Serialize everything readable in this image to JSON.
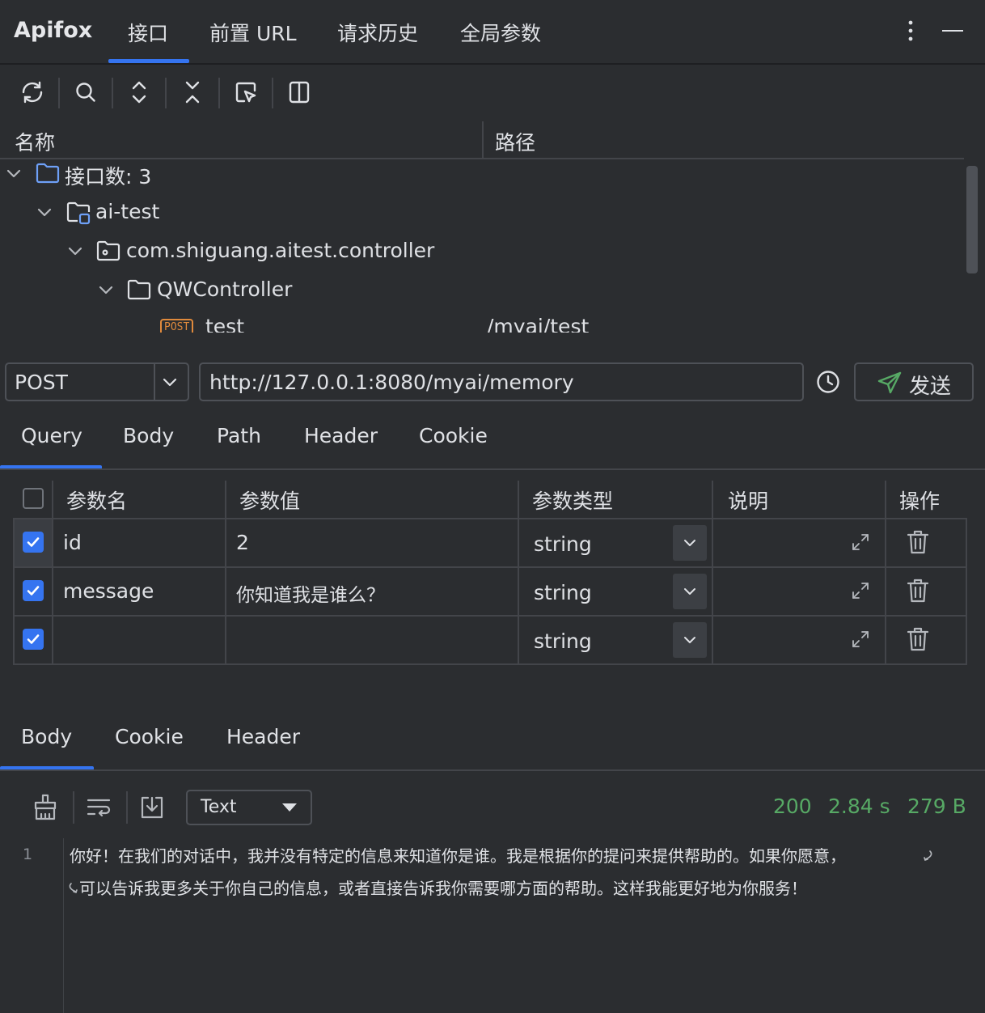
{
  "header": {
    "app_title": "Apifox",
    "tabs": [
      {
        "label": "接口",
        "active": true
      },
      {
        "label": "前置 URL",
        "active": false
      },
      {
        "label": "请求历史",
        "active": false
      },
      {
        "label": "全局参数",
        "active": false
      }
    ]
  },
  "toolbar": {
    "icons": [
      "refresh-icon",
      "search-icon",
      "expand-all-icon",
      "collapse-all-icon",
      "locate-icon",
      "split-view-icon"
    ]
  },
  "tree": {
    "col_name": "名称",
    "col_path": "路径",
    "root": "接口数: 3",
    "module": "ai-test",
    "package": "com.shiguang.aitest.controller",
    "controller": "QWController",
    "endpoint": {
      "method_badge": "POST",
      "name": "test",
      "path": "/myai/test"
    }
  },
  "request": {
    "method": "POST",
    "url": "http://127.0.0.1:8080/myai/memory",
    "send_label": "发送",
    "tabs": [
      "Query",
      "Body",
      "Path",
      "Header",
      "Cookie"
    ],
    "active_tab": "Query"
  },
  "params": {
    "headers": {
      "name": "参数名",
      "value": "参数值",
      "type": "参数类型",
      "desc": "说明",
      "action": "操作"
    },
    "rows": [
      {
        "checked": true,
        "name": "id",
        "value": "2",
        "type": "string",
        "desc": ""
      },
      {
        "checked": true,
        "name": "message",
        "value": "你知道我是谁么？",
        "type": "string",
        "desc": ""
      },
      {
        "checked": true,
        "name": "",
        "value": "",
        "type": "string",
        "desc": ""
      }
    ]
  },
  "response": {
    "tabs": [
      "Body",
      "Cookie",
      "Header"
    ],
    "active_tab": "Body",
    "format": "Text",
    "status_code": "200",
    "time": "2.84 s",
    "size": "279 B",
    "line_number": "1",
    "body_line1": "你好！在我们的对话中，我并没有特定的信息来知道你是谁。我是根据你的提问来提供帮助的。如果你愿意，",
    "body_line2": "可以告诉我更多关于你自己的信息，或者直接告诉我你需要哪方面的帮助。这样我能更好地为你服务！"
  },
  "colors": {
    "accent": "#3574f0",
    "status_green": "#57a965",
    "post_orange": "#e08a3c",
    "background": "#2b2d30"
  }
}
